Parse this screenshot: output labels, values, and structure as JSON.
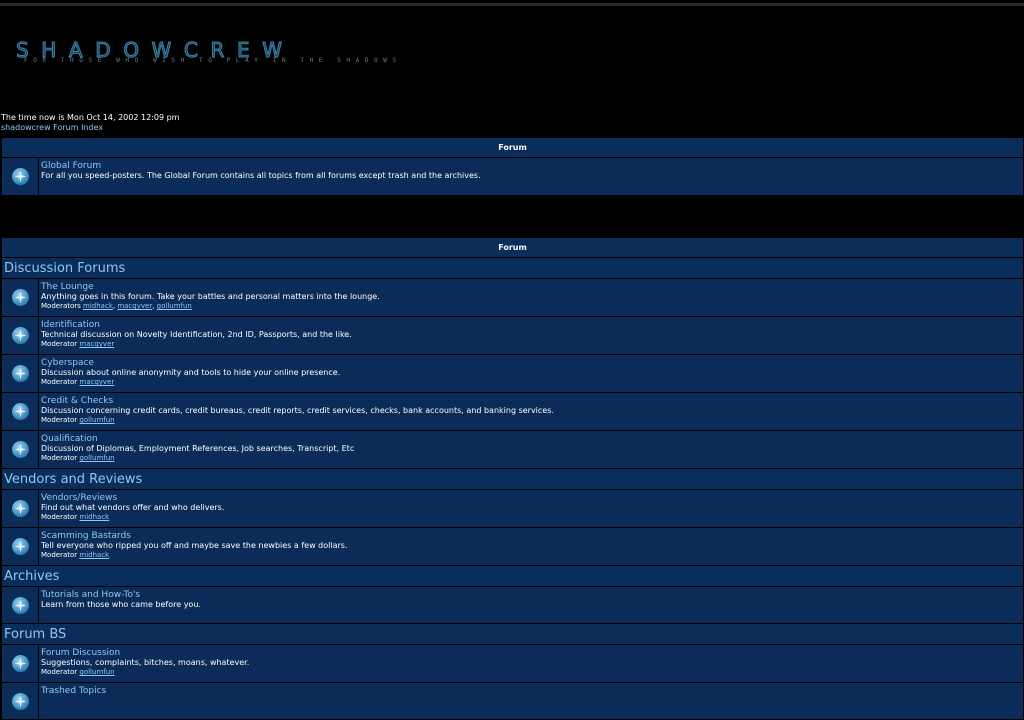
{
  "header": {
    "logo_title": "SHADOWCREW",
    "logo_tagline": "FOR THOSE WHO WISH TO PLAY IN THE SHADOWS",
    "time_text": "The time now is Mon Oct 14, 2002 12:09 pm",
    "index_link": "shadowcrew Forum Index"
  },
  "table1": {
    "header": "Forum",
    "forums": [
      {
        "name": "Global Forum",
        "desc": "For all you speed-posters. The Global Forum contains all topics from all forums except trash and the archives."
      }
    ]
  },
  "table2": {
    "header": "Forum",
    "categories": [
      {
        "name": "Discussion Forums",
        "forums": [
          {
            "name": "The Lounge",
            "desc": "Anything goes in this forum. Take your battles and personal matters into the lounge.",
            "mod_label": "Moderators",
            "mods": [
              "midhack",
              "macgyver",
              "gollumfun"
            ]
          },
          {
            "name": "Identification",
            "desc": "Technical discussion on Novelty Identification, 2nd ID, Passports, and the like.",
            "mod_label": "Moderator",
            "mods": [
              "macgyver"
            ]
          },
          {
            "name": "Cyberspace",
            "desc": "Discussion about online anonymity and tools to hide your online presence.",
            "mod_label": "Moderator",
            "mods": [
              "macgyver"
            ]
          },
          {
            "name": "Credit & Checks",
            "desc": "Discussion concerning credit cards, credit bureaus, credit reports, credit services, checks, bank accounts, and banking services.",
            "mod_label": "Moderator",
            "mods": [
              "gollumfun"
            ]
          },
          {
            "name": "Qualification",
            "desc": "Discussion of Diplomas, Employment References, Job searches, Transcript, Etc",
            "mod_label": "Moderator",
            "mods": [
              "gollumfun"
            ]
          }
        ]
      },
      {
        "name": "Vendors and Reviews",
        "forums": [
          {
            "name": "Vendors/Reviews",
            "desc": "Find out what vendors offer and who delivers.",
            "mod_label": "Moderator",
            "mods": [
              "midhack"
            ]
          },
          {
            "name": "Scamming Bastards",
            "desc": "Tell everyone who ripped you off and maybe save the newbies a few dollars.",
            "mod_label": "Moderator",
            "mods": [
              "midhack"
            ]
          }
        ]
      },
      {
        "name": "Archives",
        "forums": [
          {
            "name": "Tutorials and How-To's",
            "desc": "Learn from those who came before you.",
            "mod_label": "",
            "mods": []
          }
        ]
      },
      {
        "name": "Forum BS",
        "forums": [
          {
            "name": "Forum Discussion",
            "desc": "Suggestions, complaints, bitches, moans, whatever.",
            "mod_label": "Moderator",
            "mods": [
              "gollumfun"
            ]
          },
          {
            "name": "Trashed Topics",
            "desc": "",
            "mod_label": "",
            "mods": []
          }
        ]
      }
    ]
  },
  "colors": {
    "accent": "#8ec7f2",
    "row_bg": "#0b2c59",
    "page_bg": "#000000"
  },
  "icons": {
    "forum_icon": "forum-folder-icon"
  }
}
